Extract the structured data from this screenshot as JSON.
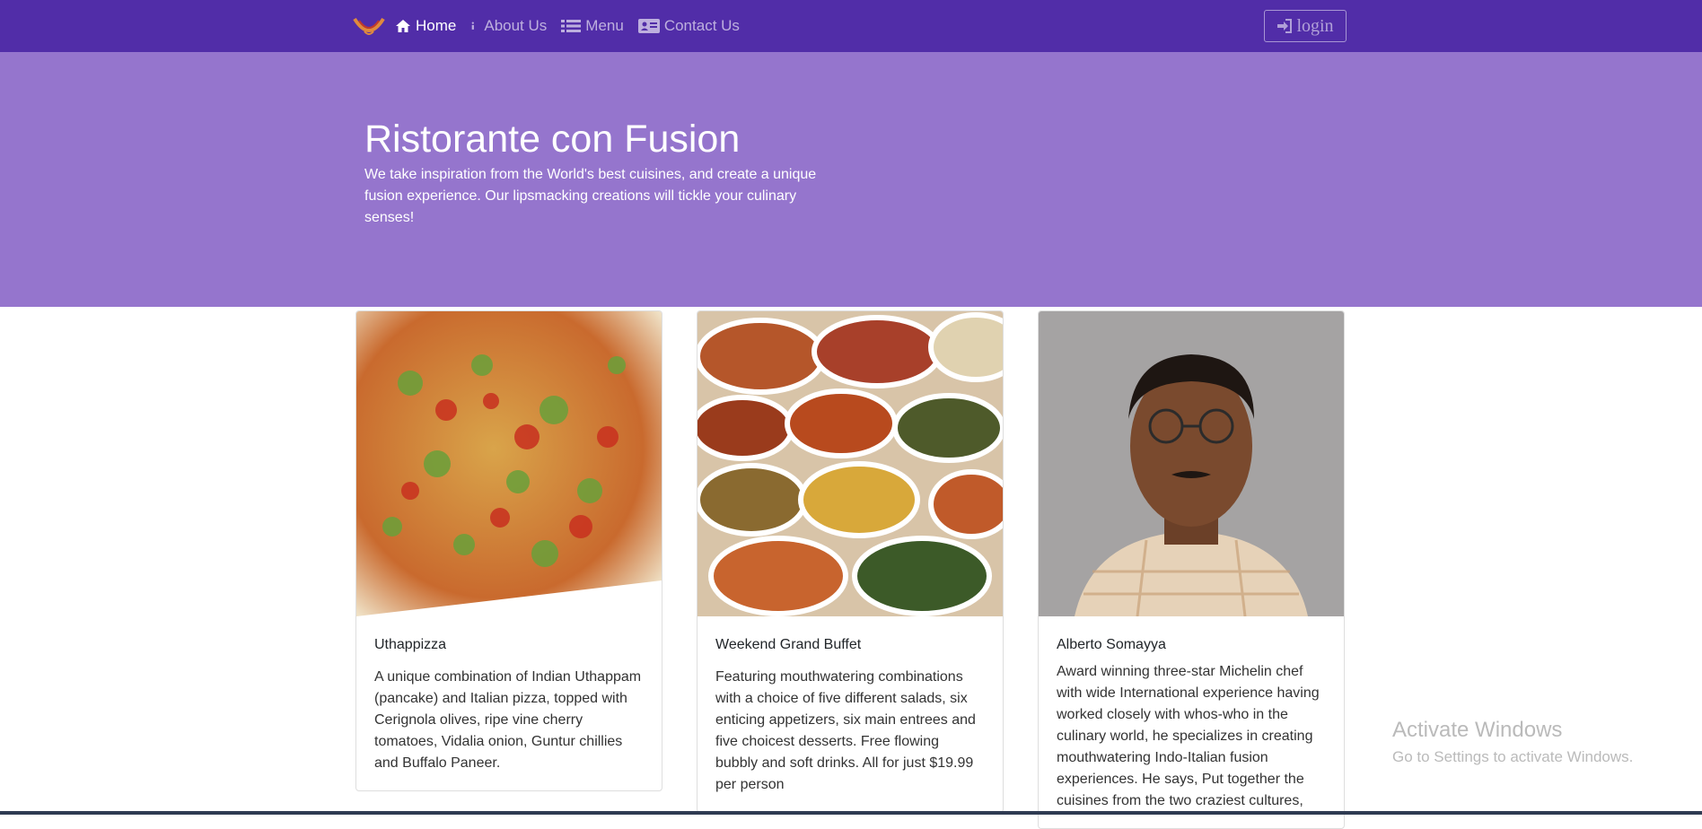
{
  "nav": {
    "items": [
      {
        "label": "Home",
        "icon": "home-icon",
        "active": true
      },
      {
        "label": "About Us",
        "icon": "info-icon",
        "active": false
      },
      {
        "label": "Menu",
        "icon": "list-icon",
        "active": false
      },
      {
        "label": "Contact Us",
        "icon": "address-card-icon",
        "active": false
      }
    ],
    "login_label": "login"
  },
  "hero": {
    "title": "Ristorante con Fusion",
    "text": "We take inspiration from the World's best cuisines, and create a unique fusion experience. Our lipsmacking creations will tickle your culinary senses!"
  },
  "cards": [
    {
      "title": "Uthappizza",
      "text": "A unique combination of Indian Uthappam (pancake) and Italian pizza, topped with Cerignola olives, ripe vine cherry tomatoes, Vidalia onion, Guntur chillies and Buffalo Paneer."
    },
    {
      "title": "Weekend Grand Buffet",
      "text": "Featuring mouthwatering combinations with a choice of five different salads, six enticing appetizers, six main entrees and five choicest desserts. Free flowing bubbly and soft drinks. All for just $19.99 per person"
    },
    {
      "title": "Alberto Somayya",
      "text": "Award winning three-star Michelin chef with wide International experience having worked closely with whos-who in the culinary world, he specializes in creating mouthwatering Indo-Italian fusion experiences. He says, Put together the cuisines from the two craziest cultures,"
    }
  ],
  "watermark": {
    "line1": "Activate Windows",
    "line2": "Go to Settings to activate Windows."
  },
  "colors": {
    "navbar": "#512da8",
    "jumbotron": "#9575cd"
  }
}
